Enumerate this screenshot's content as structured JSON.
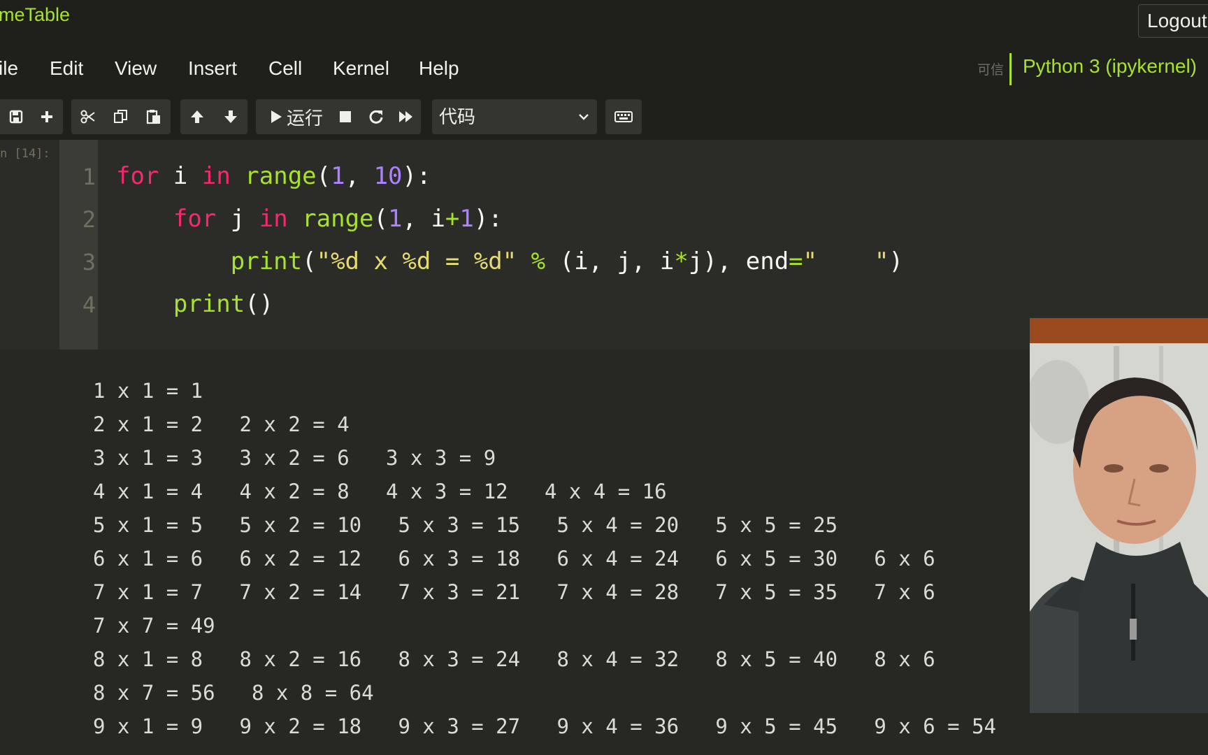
{
  "header": {
    "notebook_title": "meTable",
    "logout_label": "Logout"
  },
  "menu": {
    "items": [
      "ile",
      "Edit",
      "View",
      "Insert",
      "Cell",
      "Kernel",
      "Help"
    ],
    "trusted_label": "可信",
    "kernel_name": "Python 3 (ipykernel)"
  },
  "toolbar": {
    "run_label": "运行",
    "cell_type": "代码",
    "icons": [
      "save-icon",
      "plus-icon",
      "scissors-icon",
      "copy-icon",
      "paste-icon",
      "arrow-up-icon",
      "arrow-down-icon",
      "play-icon",
      "stop-icon",
      "restart-icon",
      "fast-forward-icon",
      "chevron-down-icon",
      "keyboard-icon"
    ]
  },
  "cell": {
    "prompt": "n [14]:",
    "line_numbers": [
      "1",
      "2",
      "3",
      "4"
    ]
  },
  "output": {
    "lines": [
      "1 x 1 = 1",
      "2 x 1 = 2   2 x 2 = 4",
      "3 x 1 = 3   3 x 2 = 6   3 x 3 = 9",
      "4 x 1 = 4   4 x 2 = 8   4 x 3 = 12   4 x 4 = 16",
      "5 x 1 = 5   5 x 2 = 10   5 x 3 = 15   5 x 4 = 20   5 x 5 = 25",
      "6 x 1 = 6   6 x 2 = 12   6 x 3 = 18   6 x 4 = 24   6 x 5 = 30   6 x 6",
      "7 x 1 = 7   7 x 2 = 14   7 x 3 = 21   7 x 4 = 28   7 x 5 = 35   7 x 6",
      "7 x 7 = 49",
      "8 x 1 = 8   8 x 2 = 16   8 x 3 = 24   8 x 4 = 32   8 x 5 = 40   8 x 6",
      "8 x 7 = 56   8 x 8 = 64",
      "9 x 1 = 9   9 x 2 = 18   9 x 3 = 27   9 x 4 = 36   9 x 5 = 45   9 x 6 = 54"
    ]
  },
  "colors": {
    "accent_green": "#a6e22e",
    "keyword_pink": "#f92672",
    "number_purple": "#ae81ff",
    "string_yellow": "#e6db74",
    "background": "#272822"
  }
}
